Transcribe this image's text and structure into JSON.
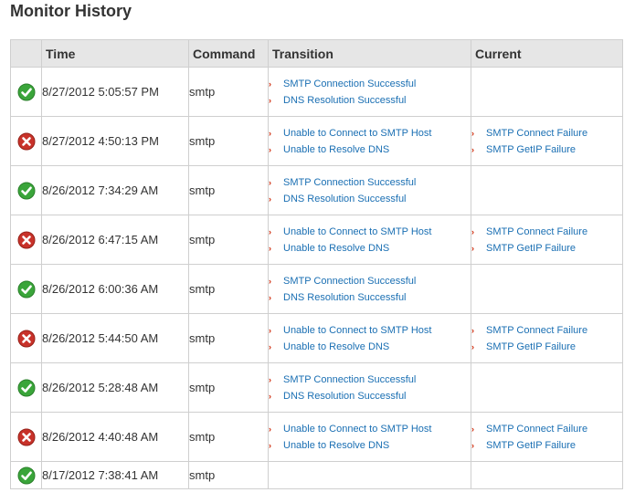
{
  "page": {
    "title": "Monitor History"
  },
  "columns": {
    "status": "",
    "time": "Time",
    "command": "Command",
    "transition": "Transition",
    "current": "Current"
  },
  "rows": [
    {
      "status": "ok",
      "status_icon": "check-icon",
      "time": "8/27/2012 5:05:57 PM",
      "command": "smtp",
      "transition": [
        "SMTP Connection Successful",
        "DNS Resolution Successful"
      ],
      "current": []
    },
    {
      "status": "fail",
      "status_icon": "x-icon",
      "time": "8/27/2012 4:50:13 PM",
      "command": "smtp",
      "transition": [
        "Unable to Connect to SMTP Host",
        "Unable to Resolve DNS"
      ],
      "current": [
        "SMTP Connect Failure",
        "SMTP GetIP Failure"
      ]
    },
    {
      "status": "ok",
      "status_icon": "check-icon",
      "time": "8/26/2012 7:34:29 AM",
      "command": "smtp",
      "transition": [
        "SMTP Connection Successful",
        "DNS Resolution Successful"
      ],
      "current": []
    },
    {
      "status": "fail",
      "status_icon": "x-icon",
      "time": "8/26/2012 6:47:15 AM",
      "command": "smtp",
      "transition": [
        "Unable to Connect to SMTP Host",
        "Unable to Resolve DNS"
      ],
      "current": [
        "SMTP Connect Failure",
        "SMTP GetIP Failure"
      ]
    },
    {
      "status": "ok",
      "status_icon": "check-icon",
      "time": "8/26/2012 6:00:36 AM",
      "command": "smtp",
      "transition": [
        "SMTP Connection Successful",
        "DNS Resolution Successful"
      ],
      "current": []
    },
    {
      "status": "fail",
      "status_icon": "x-icon",
      "time": "8/26/2012 5:44:50 AM",
      "command": "smtp",
      "transition": [
        "Unable to Connect to SMTP Host",
        "Unable to Resolve DNS"
      ],
      "current": [
        "SMTP Connect Failure",
        "SMTP GetIP Failure"
      ]
    },
    {
      "status": "ok",
      "status_icon": "check-icon",
      "time": "8/26/2012 5:28:48 AM",
      "command": "smtp",
      "transition": [
        "SMTP Connection Successful",
        "DNS Resolution Successful"
      ],
      "current": []
    },
    {
      "status": "fail",
      "status_icon": "x-icon",
      "time": "8/26/2012 4:40:48 AM",
      "command": "smtp",
      "transition": [
        "Unable to Connect to SMTP Host",
        "Unable to Resolve DNS"
      ],
      "current": [
        "SMTP Connect Failure",
        "SMTP GetIP Failure"
      ]
    },
    {
      "status": "ok",
      "status_icon": "check-icon",
      "time": "8/17/2012 7:38:41 AM",
      "command": "smtp",
      "transition": [],
      "current": []
    }
  ],
  "colors": {
    "ok": "#3aa53a",
    "fail": "#c8322a",
    "link": "#1a6fb3",
    "arrow": "#cc2200",
    "header_bg": "#e6e6e6"
  }
}
